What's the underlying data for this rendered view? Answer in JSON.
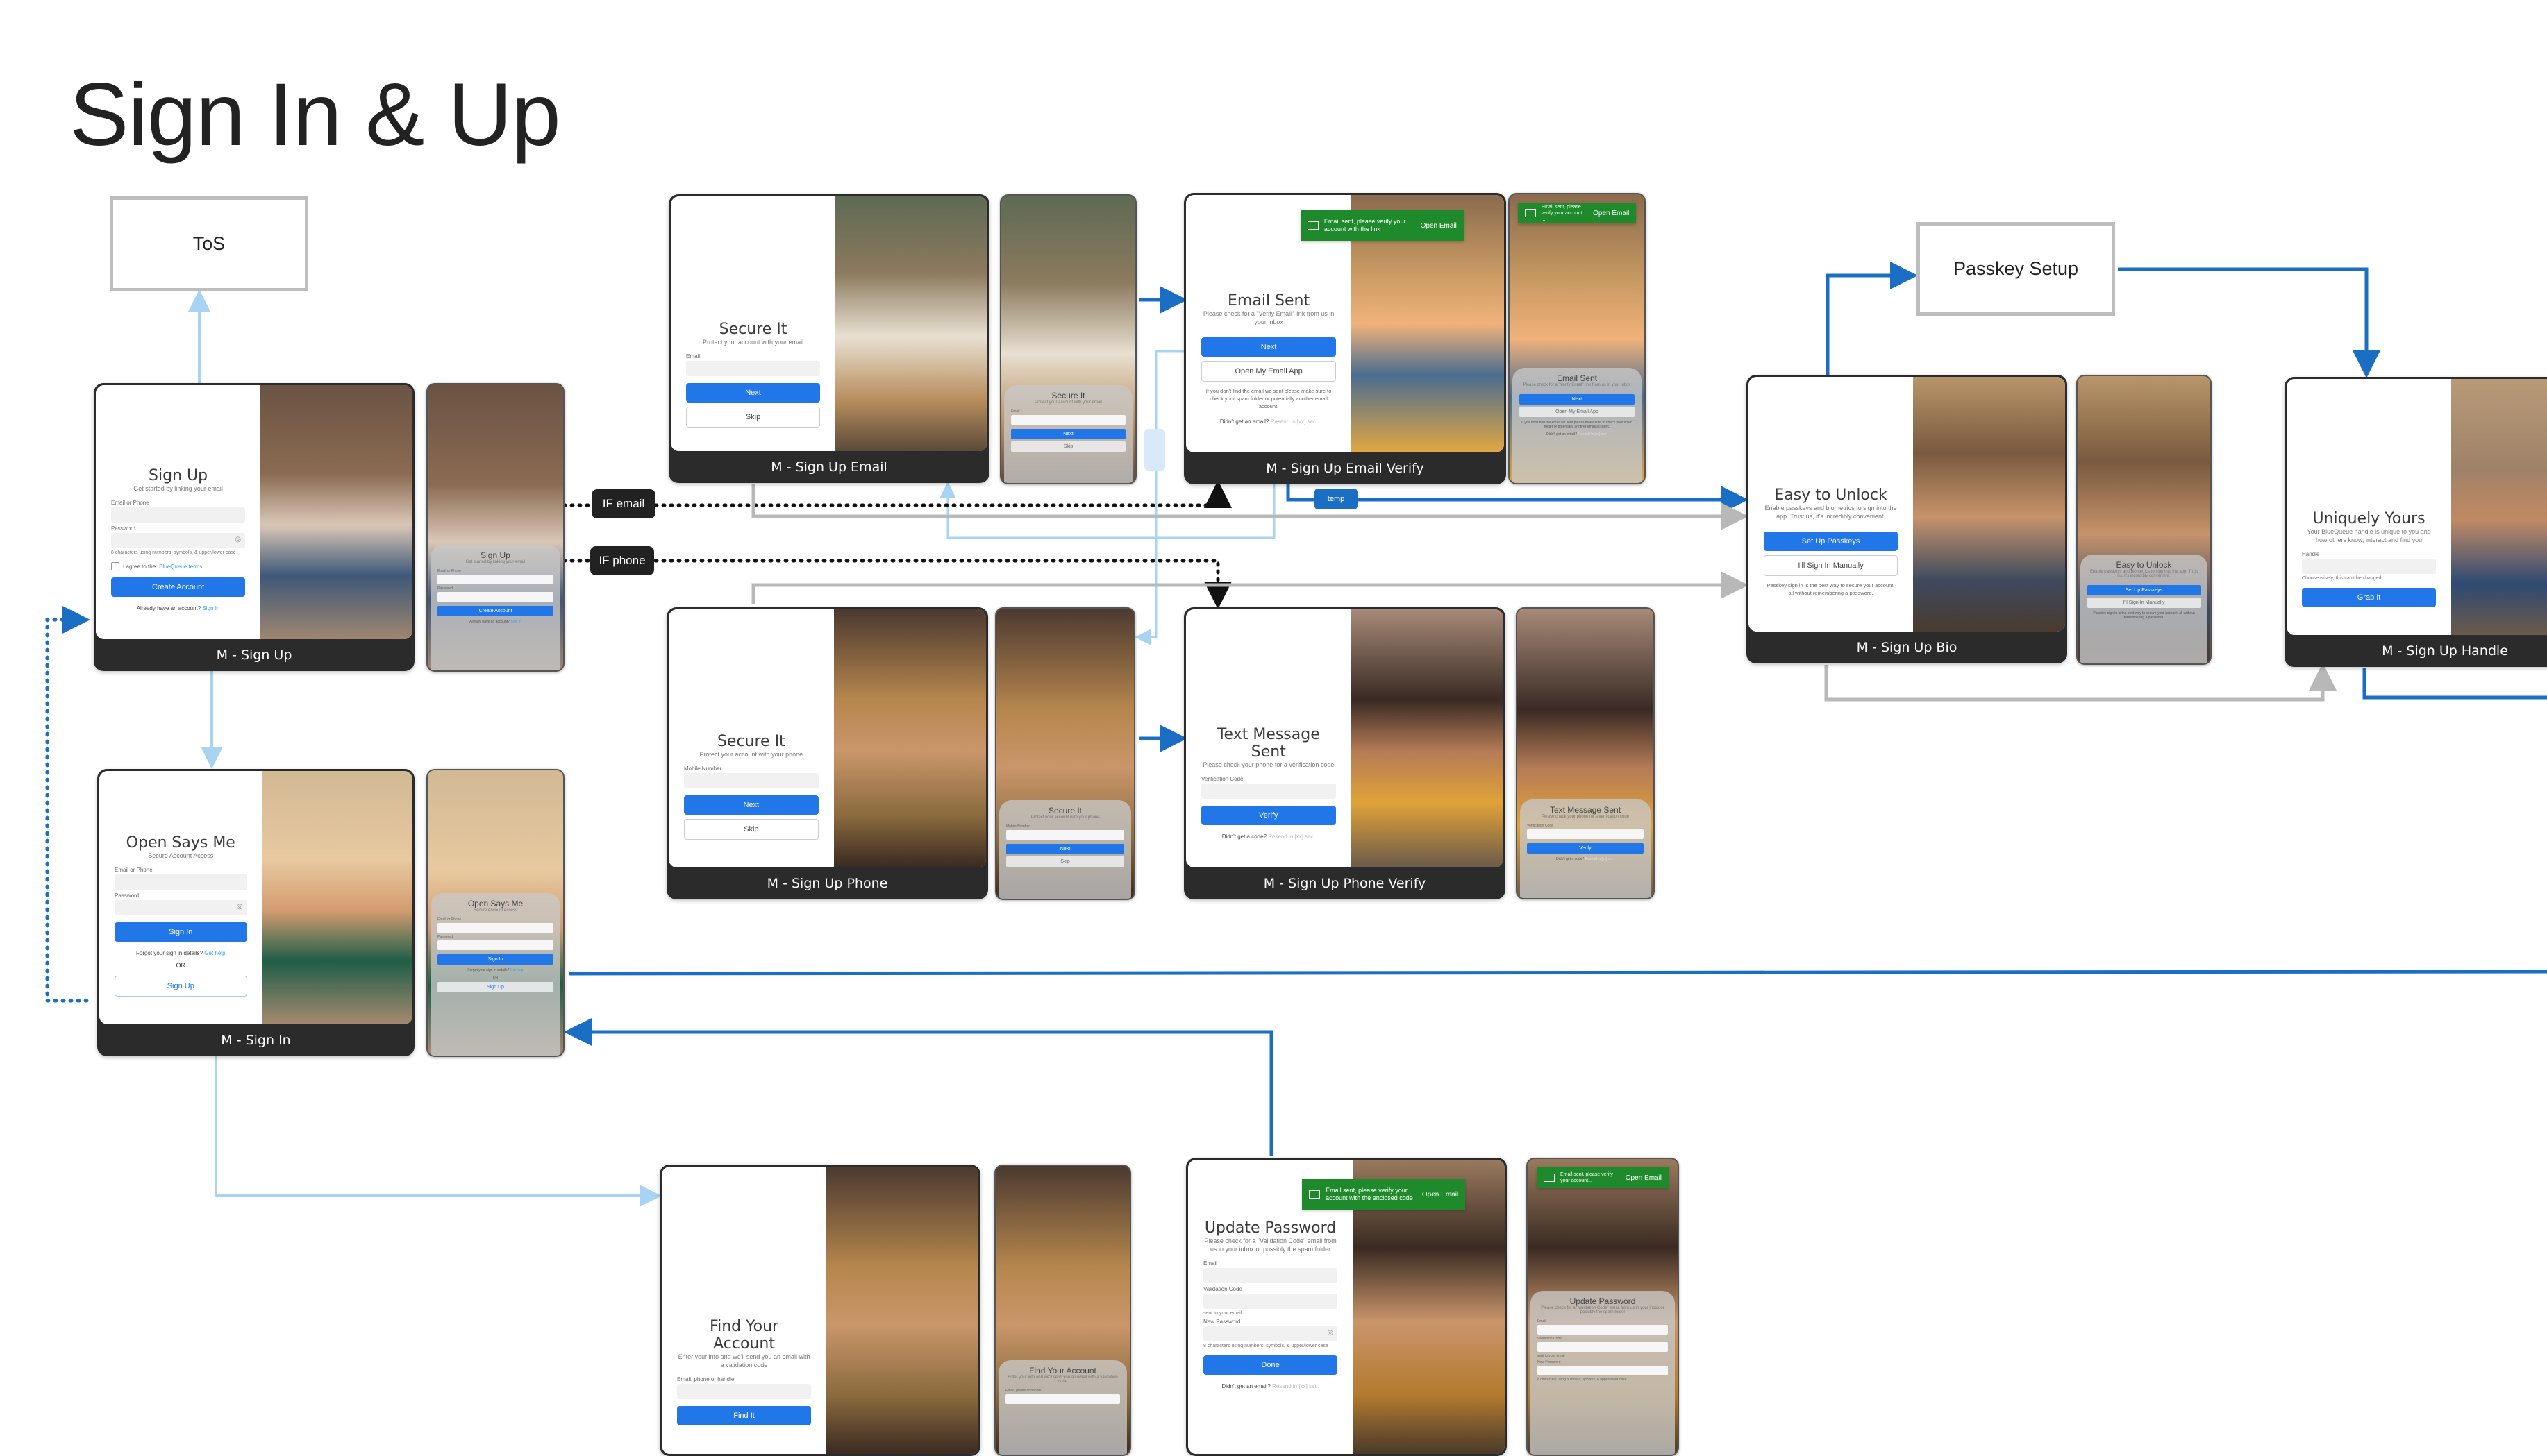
{
  "page": {
    "title": "Sign In & Up"
  },
  "notes": {
    "tos": "ToS",
    "passkey_setup": "Passkey Setup"
  },
  "tags": {
    "if_email": "IF email",
    "if_phone": "IF phone",
    "temp": "temp"
  },
  "colors": {
    "primary": "#2176e8",
    "flow_dark_blue": "#1a6fc4",
    "flow_light_blue": "#a6d4f2",
    "flow_gray": "#b8b8b8",
    "toast_green": "#1f8a2b",
    "caption_bg": "#2b2b2b"
  },
  "screens": {
    "sign_up": {
      "caption": "M - Sign Up",
      "title": "Sign Up",
      "subtitle": "Get started by linking your email",
      "email_label": "Email or Phone",
      "password_label": "Password",
      "password_hint": "8 characters using numbers, symbols, & upper/lower case",
      "terms_prefix": "I agree to the",
      "terms_link": "BlueQueue terms",
      "create_button": "Create Account",
      "have_account": "Already have an account?",
      "sign_in_link": "Sign In"
    },
    "sign_in": {
      "caption": "M - Sign In",
      "title": "Open Says Me",
      "subtitle": "Secure Account Access",
      "email_label": "Email or Phone",
      "password_label": "Password",
      "sign_in_button": "Sign In",
      "forgot_text": "Forgot your sign in details?",
      "get_help_link": "Get help",
      "or_text": "OR",
      "sign_up_button": "Sign Up"
    },
    "sign_up_email": {
      "caption": "M - Sign Up Email",
      "title": "Secure It",
      "subtitle": "Protect your account with your email",
      "email_label": "Email",
      "next_button": "Next",
      "skip_button": "Skip"
    },
    "sign_up_email_verify": {
      "caption": "M - Sign Up Email Verify",
      "toast_text": "Email sent, please verify your account with the link",
      "toast_text_short": "Email sent, please verify your account ...",
      "toast_action": "Open Email",
      "title": "Email Sent",
      "subtitle": "Please check for a \"Verify Email\" link from us in your inbox",
      "next_button": "Next",
      "open_app_button": "Open My Email App",
      "note": "If you don't find the email we sent please make sure to check your spam folder or potentially another email account.",
      "didnt_get": "Didn't get an email?",
      "resend": "Resend in [xx] sec."
    },
    "sign_up_phone": {
      "caption": "M - Sign Up Phone",
      "title": "Secure It",
      "subtitle": "Protect your account with your phone",
      "mobile_label": "Mobile Number",
      "next_button": "Next",
      "skip_button": "Skip"
    },
    "sign_up_phone_verify": {
      "caption": "M - Sign Up Phone Verify",
      "title": "Text Message Sent",
      "subtitle": "Please check your phone for a verification code",
      "code_label": "Verification Code",
      "verify_button": "Verify",
      "didnt_get": "Didn't get a code?",
      "resend": "Resend in [xx] sec."
    },
    "sign_up_bio": {
      "caption": "M - Sign Up Bio",
      "title": "Easy to Unlock",
      "subtitle": "Enable passkeys and biometrics to sign into the app. Trust us, it's incredibly convenient.",
      "passkeys_button": "Set Up Passkeys",
      "manual_button": "I'll Sign In Manually",
      "note": "Passkey sign in is the best way to secure your account, all without remembering a password."
    },
    "sign_up_handle": {
      "caption": "M - Sign Up Handle",
      "title": "Uniquely Yours",
      "subtitle": "Your BlueQueue handle is unique to you and how others know, interact and find you",
      "handle_label": "Handle",
      "handle_hint": "Choose wisely, this can't be changed",
      "grab_button": "Grab It"
    },
    "find_account": {
      "title": "Find Your Account",
      "subtitle": "Enter your info and we'll send you an email with a validation code",
      "field_label": "Email, phone or handle",
      "find_button": "Find It"
    },
    "update_password": {
      "toast_text": "Email sent, please verify your account with the enclosed code",
      "toast_text_short": "Email sent, please verify your account...",
      "toast_action": "Open Email",
      "title": "Update Password",
      "subtitle": "Please check for a \"Validation Code\" email from us in your inbox or possibly the spam folder",
      "email_label": "Email",
      "code_label": "Validation Code",
      "code_hint": "sent to your email",
      "new_password_label": "New Password",
      "password_hint": "8 characters using numbers, symbols, & upper/lower case",
      "done_button": "Done",
      "didnt_get": "Didn't get an email?",
      "resend": "Resend in [xx] sec."
    }
  }
}
